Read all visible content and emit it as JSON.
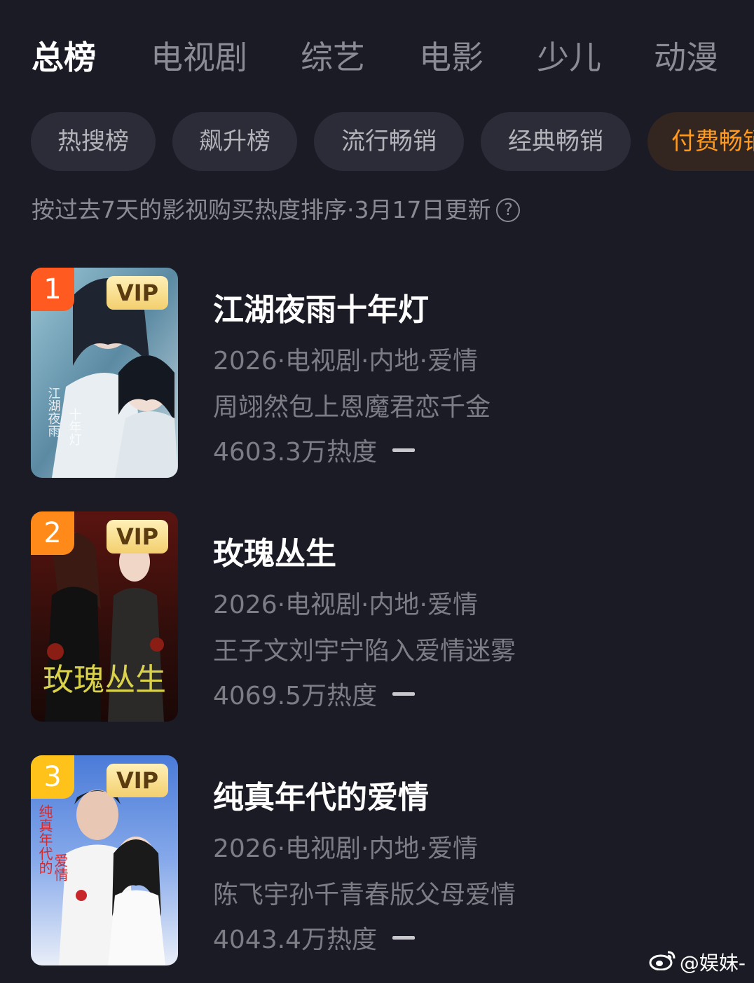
{
  "tabs": [
    {
      "label": "总榜",
      "active": true
    },
    {
      "label": "电视剧",
      "active": false
    },
    {
      "label": "综艺",
      "active": false
    },
    {
      "label": "电影",
      "active": false
    },
    {
      "label": "少儿",
      "active": false
    },
    {
      "label": "动漫",
      "active": false
    }
  ],
  "chips": [
    {
      "label": "热搜榜",
      "active": false
    },
    {
      "label": "飙升榜",
      "active": false
    },
    {
      "label": "流行畅销",
      "active": false
    },
    {
      "label": "经典畅销",
      "active": false
    },
    {
      "label": "付费畅销",
      "active": true
    }
  ],
  "subtitle": "按过去7天的影视购买热度排序·3月17日更新",
  "colors": {
    "background": "#1b1b26",
    "accent": "#ff9a1f",
    "rank_1": "#ff5a1f",
    "rank_2": "#ff8a1a",
    "rank_3": "#ffc21a",
    "vip_badge": "#f3cf6e"
  },
  "items": [
    {
      "rank": "1",
      "badge": "VIP",
      "title": "江湖夜雨十年灯",
      "meta": "2026·电视剧·内地·爱情",
      "desc": "周翊然包上恩魔君恋千金",
      "heat": "4603.3万热度",
      "trend": "flat"
    },
    {
      "rank": "2",
      "badge": "VIP",
      "title": "玫瑰丛生",
      "meta": "2026·电视剧·内地·爱情",
      "desc": "王子文刘宇宁陷入爱情迷雾",
      "heat": "4069.5万热度",
      "trend": "flat"
    },
    {
      "rank": "3",
      "badge": "VIP",
      "title": "纯真年代的爱情",
      "meta": "2026·电视剧·内地·爱情",
      "desc": "陈飞宇孙千青春版父母爱情",
      "heat": "4043.4万热度",
      "trend": "flat"
    }
  ],
  "watermark": "@娱妹-"
}
